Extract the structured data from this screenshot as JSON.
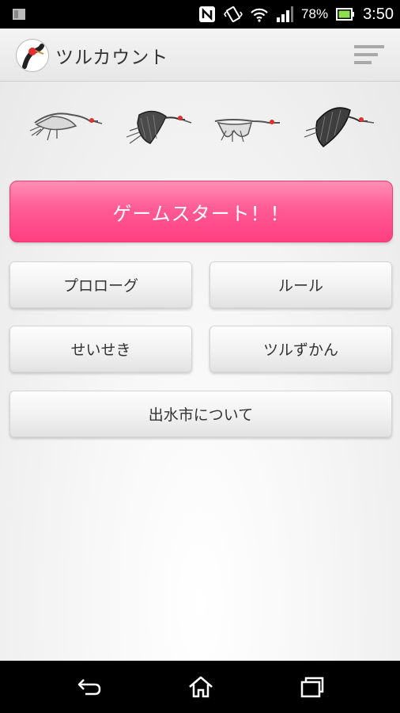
{
  "status_bar": {
    "battery_percent": "78%",
    "time": "3:50",
    "icons": [
      "notification-icon",
      "nfc-icon",
      "vibrate-icon",
      "wifi-icon",
      "signal-icon",
      "battery-icon"
    ]
  },
  "app_bar": {
    "title": "ツルカウント",
    "icons": [
      "app-logo-icon",
      "menu-icon"
    ]
  },
  "cranes": [
    "grey-crane-icon",
    "dark-crane-icon",
    "grey-crane-icon",
    "dark-crane-icon"
  ],
  "buttons": {
    "start": "ゲームスタート！！",
    "prologue": "プロローグ",
    "rules": "ルール",
    "results": "せいせき",
    "encyclopedia": "ツルずかん",
    "about_city": "出水市について"
  },
  "colors": {
    "start_button": "#ff5b95",
    "app_bar": "#ececec",
    "background": "#f3f3f3"
  },
  "nav_bar": {
    "icons": [
      "back-icon",
      "home-icon",
      "recents-icon"
    ]
  }
}
